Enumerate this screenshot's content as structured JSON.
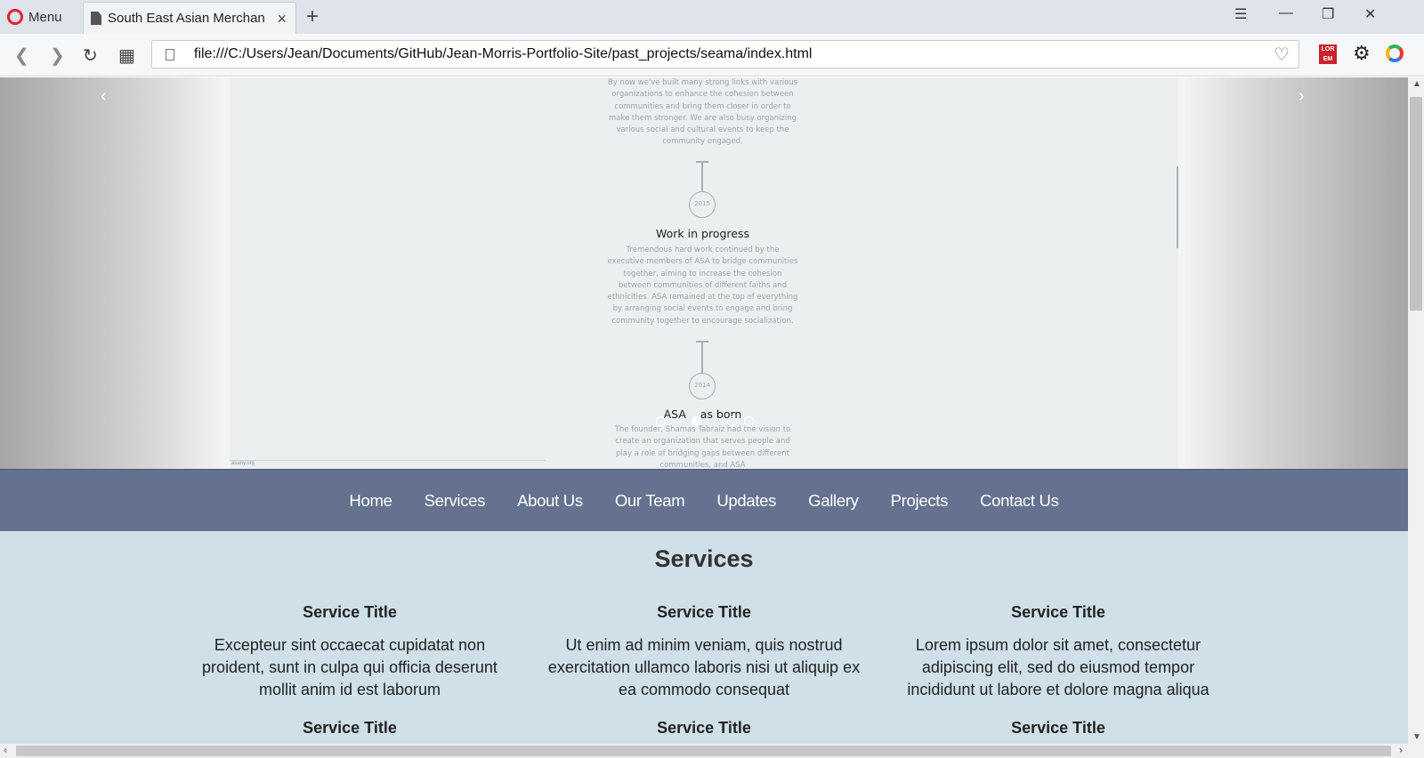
{
  "browser": {
    "menu_label": "Menu",
    "tab_title": "South East Asian Merchan",
    "tab_close": "×",
    "new_tab": "+",
    "url": "file:///C:/Users/Jean/Documents/GitHub/Jean-Morris-Portfolio-Site/past_projects/seama/index.html",
    "ext_label": "LOR EM",
    "window_controls": {
      "minimize": "—",
      "restore": "❐",
      "close": "✕",
      "tabs_menu": "☰"
    }
  },
  "carousel": {
    "prev_arrow": "‹",
    "next_arrow": "›",
    "slide": {
      "para_top": "By now we've built many strong links with various organizations to enhance the cohesion between communities and bring them closer in order to make them stronger. We are also busy organizing various social and cultural events to keep the community engaged.",
      "year_1": "2015",
      "heading_1": "Work in progress",
      "para_1": "Tremendous hard work continued by the executive members of ASA to bridge communities together, aiming to increase the cohesion between communities of different faiths and ethnicities. ASA remained at the top of everything by arranging social events to engage and bring community together to encourage socialization.",
      "year_2": "2014",
      "heading_2": "ASA    as born",
      "para_2": "The founder, Shamas Tabraiz had the vision to create an organization that serves people and play a role of bridging gaps between different communities, and ASA",
      "footer_text": "asany.org"
    },
    "active_dot": 1
  },
  "navbar": {
    "items": [
      "Home",
      "Services",
      "About Us",
      "Our Team",
      "Updates",
      "Gallery",
      "Projects",
      "Contact Us"
    ]
  },
  "services": {
    "heading": "Services",
    "items": [
      {
        "title": "Service Title",
        "body": "Excepteur sint occaecat cupidatat non proident, sunt in culpa qui officia deserunt mollit anim id est laborum"
      },
      {
        "title": "Service Title",
        "body": "Ut enim ad minim veniam, quis nostrud exercitation ullamco laboris nisi ut aliquip ex ea commodo consequat"
      },
      {
        "title": "Service Title",
        "body": "Lorem ipsum dolor sit amet, consectetur adipiscing elit, sed do eiusmod tempor incididunt ut labore et dolore magna aliqua"
      },
      {
        "title": "Service Title"
      },
      {
        "title": "Service Title"
      },
      {
        "title": "Service Title"
      }
    ]
  }
}
